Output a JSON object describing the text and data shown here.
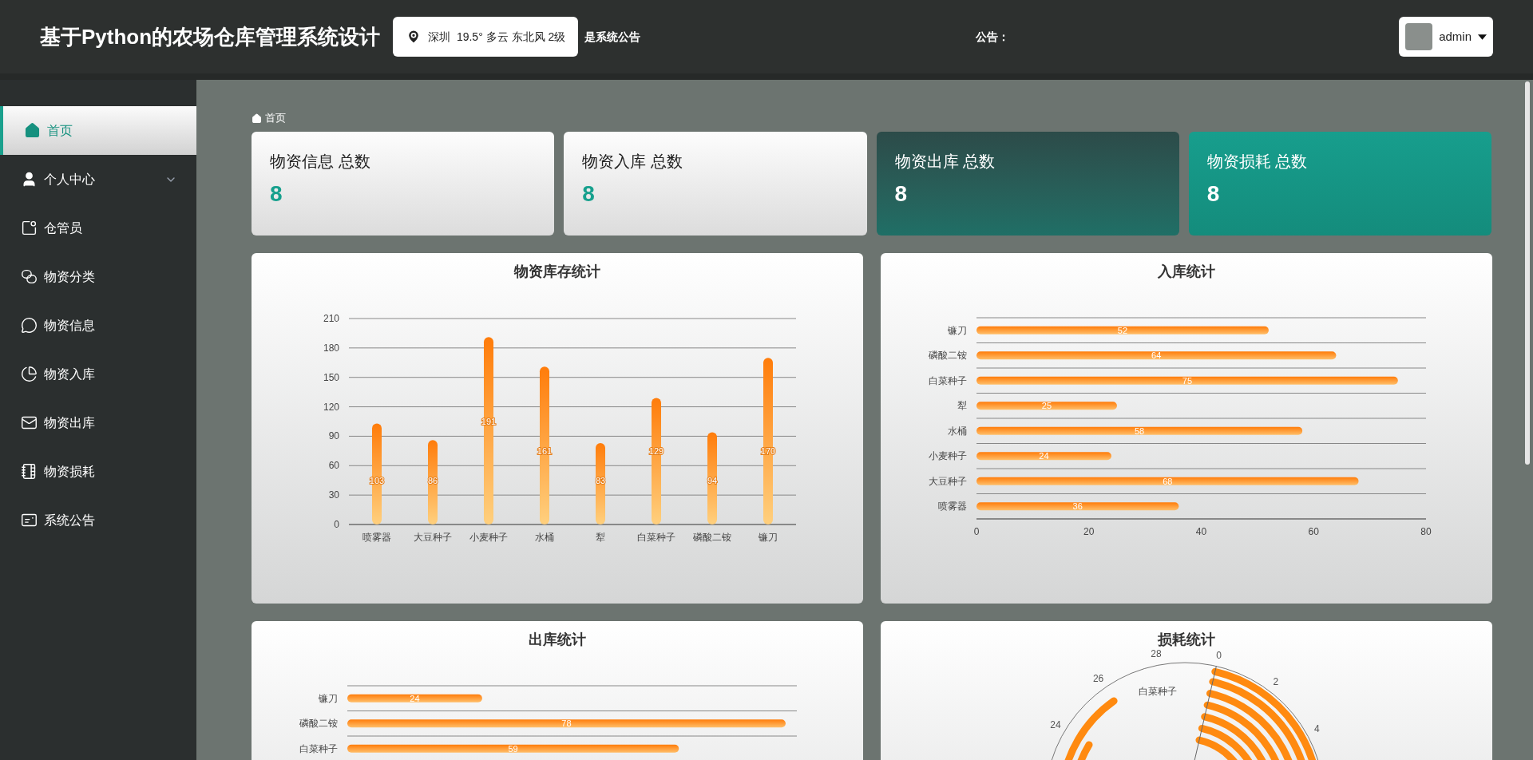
{
  "header": {
    "title": "基于Python的农场仓库管理系统设计",
    "weather": "深圳  19.5° 多云 东北风 2级",
    "marquee": "是系统公告",
    "notice_label": "公告：",
    "user": "admin"
  },
  "sidebar": {
    "items": [
      {
        "label": "首页",
        "kind": "link",
        "selected": true
      },
      {
        "label": "个人中心",
        "kind": "submenu",
        "expanded": false,
        "selected": false
      },
      {
        "label": "仓管员",
        "kind": "link",
        "selected": false
      },
      {
        "label": "物资分类",
        "kind": "link",
        "selected": false
      },
      {
        "label": "物资信息",
        "kind": "link",
        "selected": false
      },
      {
        "label": "物资入库",
        "kind": "link",
        "selected": false
      },
      {
        "label": "物资出库",
        "kind": "link",
        "selected": false
      },
      {
        "label": "物资损耗",
        "kind": "link",
        "selected": false
      },
      {
        "label": "系统公告",
        "kind": "link",
        "selected": false
      }
    ]
  },
  "breadcrumb": "首页",
  "stats": [
    {
      "label": "物资信息 总数",
      "value": "8",
      "kind": "light"
    },
    {
      "label": "物资入库 总数",
      "value": "8",
      "kind": "light"
    },
    {
      "label": "物资出库 总数",
      "value": "8",
      "kind": "dark"
    },
    {
      "label": "物资损耗 总数",
      "value": "8",
      "kind": "teal"
    }
  ],
  "stock_chart": {
    "chart_data": {
      "type": "bar",
      "title": "物资库存统计",
      "categories": [
        "喷雾器",
        "大豆种子",
        "小麦种子",
        "水桶",
        "犁",
        "白菜种子",
        "磷酸二铵",
        "镰刀"
      ],
      "values": [
        103,
        86,
        191,
        161,
        83,
        129,
        94,
        170
      ],
      "ylim": [
        0,
        210
      ],
      "grid": true,
      "yticks": [
        0,
        30,
        60,
        90,
        120,
        150,
        180,
        210
      ],
      "data_labels": true
    }
  },
  "in_chart": {
    "chart_data": {
      "type": "bar",
      "orientation": "horizontal",
      "title": "入库统计",
      "categories": [
        "镰刀",
        "磷酸二铵",
        "白菜种子",
        "犁",
        "水桶",
        "小麦种子",
        "大豆种子",
        "喷雾器"
      ],
      "values": [
        52,
        64,
        75,
        25,
        58,
        24,
        68,
        36
      ],
      "xlim": [
        0,
        80
      ],
      "xticks": [
        0,
        20,
        40,
        60,
        80
      ],
      "grid": true,
      "data_labels": true
    }
  },
  "out_chart": {
    "chart_data": {
      "type": "bar",
      "orientation": "horizontal",
      "title": "出库统计",
      "categories": [
        "镰刀",
        "磷酸二铵",
        "白菜种子"
      ],
      "values": [
        24,
        78,
        59
      ],
      "xlim": [
        0,
        80
      ],
      "grid": true,
      "data_labels": true
    }
  },
  "loss_chart": {
    "title": "损耗统计",
    "angle_ticks": [
      "0",
      "2",
      "4",
      "24",
      "26",
      "28"
    ],
    "category_label": "白菜种子"
  }
}
